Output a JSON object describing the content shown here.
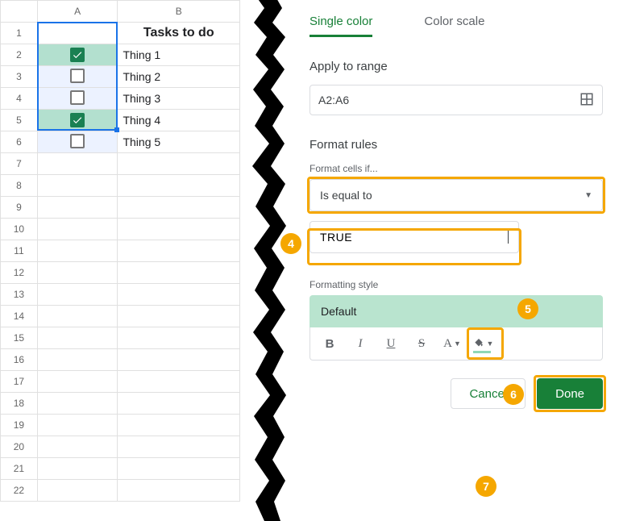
{
  "sheet": {
    "columns": [
      "A",
      "B"
    ],
    "header": "Tasks to do",
    "rows": [
      {
        "checked": true,
        "label": "Thing 1"
      },
      {
        "checked": false,
        "label": "Thing 2"
      },
      {
        "checked": false,
        "label": "Thing 3"
      },
      {
        "checked": true,
        "label": "Thing 4"
      },
      {
        "checked": false,
        "label": "Thing 5"
      }
    ],
    "empty_rows_after": 16
  },
  "panel": {
    "tabs": {
      "single": "Single color",
      "scale": "Color scale"
    },
    "apply_label": "Apply to range",
    "range": "A2:A6",
    "rules_label": "Format rules",
    "condition_label": "Format cells if...",
    "condition": "Is equal to",
    "value": "TRUE",
    "style_label": "Formatting style",
    "style_preview": "Default",
    "format_buttons": {
      "bold": "B",
      "italic": "I",
      "underline": "U",
      "strike": "S",
      "textcolor": "A",
      "fillcolor": "fill"
    },
    "cancel": "Cancel",
    "done": "Done"
  },
  "annotations": {
    "4": "4",
    "5": "5",
    "6": "6",
    "7": "7"
  }
}
